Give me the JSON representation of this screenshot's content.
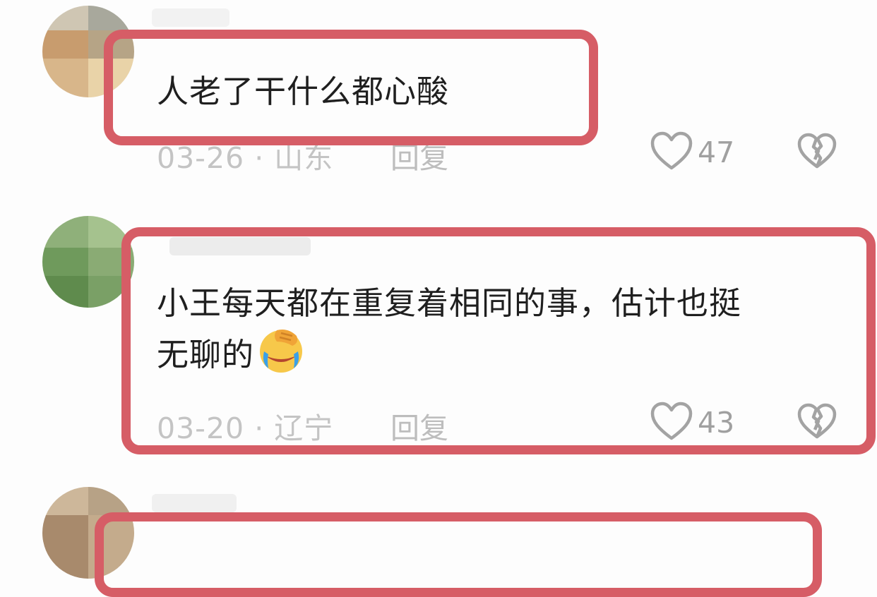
{
  "comments": [
    {
      "text_lines": [
        "人老了干什么都心酸"
      ],
      "date": "03-26",
      "location": "山东",
      "reply_label": "回复",
      "likes": "47"
    },
    {
      "text_lines": [
        "小王每天都在重复着相同的事，估计也挺",
        "无聊的"
      ],
      "emoji": "face-with-hand-over-eyes-crying-emoji",
      "date": "03-20",
      "location": "辽宁",
      "reply_label": "回复",
      "likes": "43"
    }
  ],
  "separator": "·",
  "colors": {
    "highlight_border": "#d65d66",
    "text": "#1f1f1f",
    "meta": "#c4c4c4"
  },
  "icons": [
    "heart-outline-icon",
    "broken-heart-icon"
  ]
}
